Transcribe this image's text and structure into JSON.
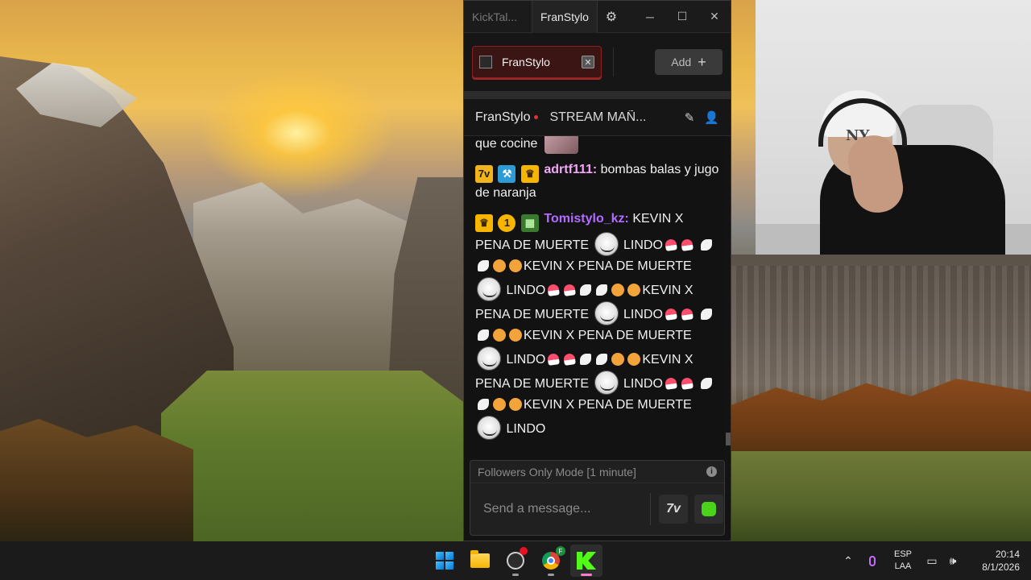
{
  "window": {
    "app_title": "KickTal...",
    "active_tab": "FranStylo",
    "controls": {
      "minimize": "─",
      "maximize": "☐",
      "close": "✕"
    }
  },
  "tabs": {
    "channel_tab_label": "FranStylo",
    "close_glyph": "✕",
    "add_label": "Add",
    "add_glyph": "+"
  },
  "chat_header": {
    "channel": "FranStylo",
    "stream_title": "STREAM MAÑ...",
    "live_color": "#e03232"
  },
  "messages": [
    {
      "text": "que cocine"
    },
    {
      "username": "adrtf111:",
      "text": "bombas balas y jugo de naranja"
    },
    {
      "username": "Tomistylo_kz:",
      "segments": [
        "KEVIN X PENA DE MUERTE",
        "LINDO",
        "KEVIN X PENA DE MUERTE",
        "LINDO",
        "KEVIN X PENA DE MUERTE",
        "LINDO",
        "KEVIN X PENA DE MUERTE",
        "LINDO",
        "KEVIN X PENA DE MUERTE",
        "LINDO",
        "KEVIN X PENA DE MUERTE",
        "LINDO"
      ]
    }
  ],
  "composer": {
    "mode_notice": "Followers Only Mode [1 minute]",
    "placeholder": "Send a message...",
    "info_glyph": "i",
    "emote_glyph": "7v"
  },
  "webcam": {
    "cap_logo": "NY"
  },
  "taskbar": {
    "apps": [
      "start-icon",
      "file-explorer-icon",
      "obs-icon",
      "chrome-icon",
      "kick-icon"
    ],
    "chrome_badge": "F",
    "language_top": "ESP",
    "language_bottom": "LAA",
    "time": "20:14",
    "date": "8/1/2026",
    "tray_chevron": "⌃",
    "network_glyph": "▭",
    "volume_glyph": "🕪"
  },
  "colors": {
    "kick_green": "#53fc18",
    "username_a": "#f1a8f5",
    "username_b": "#b26cff",
    "tab_red": "#8a1f1f"
  }
}
